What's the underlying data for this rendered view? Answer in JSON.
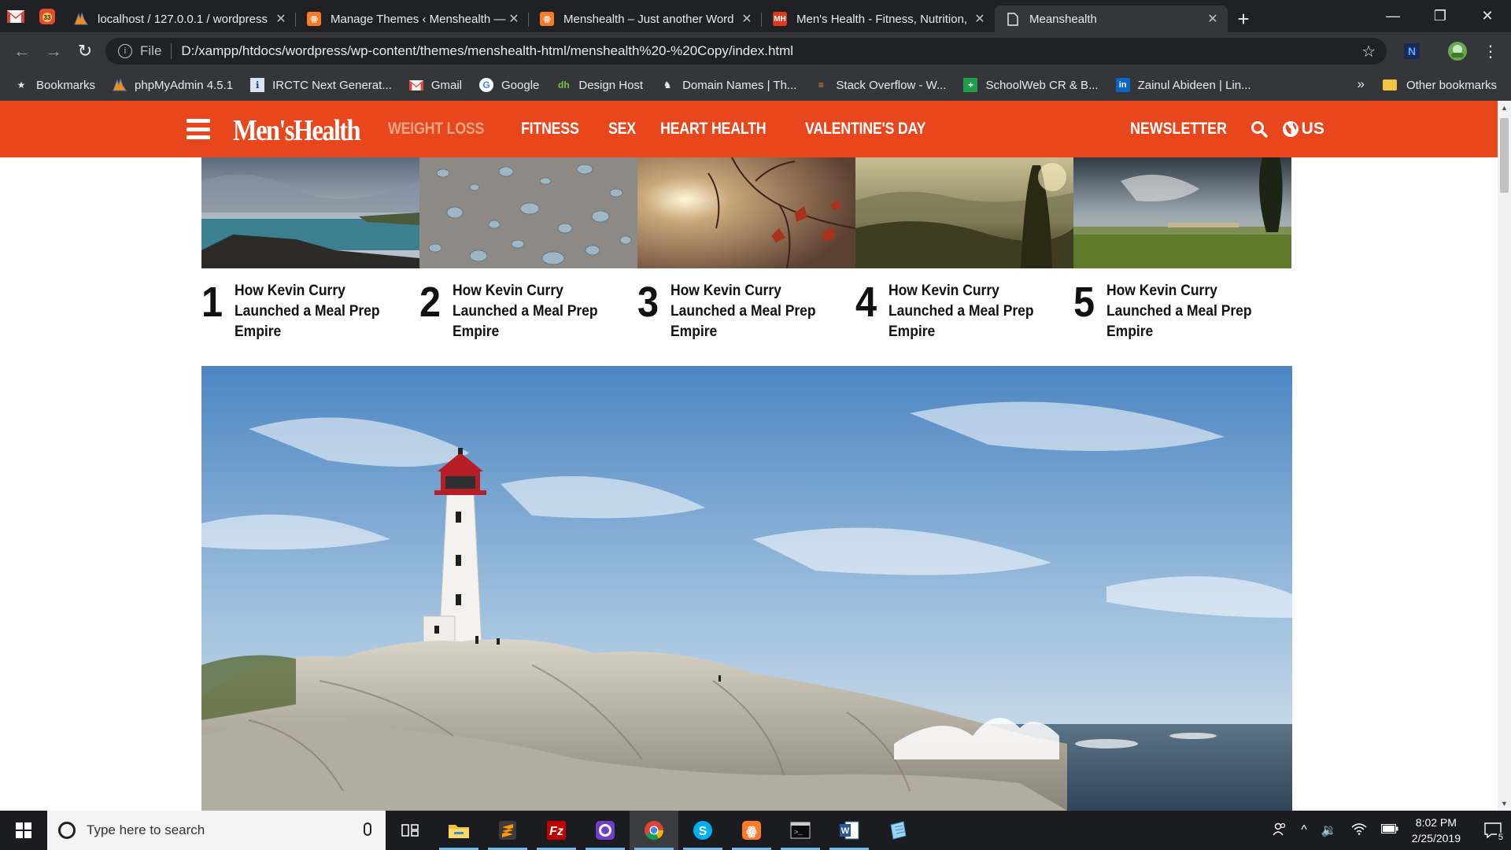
{
  "browser": {
    "tabs": [
      {
        "title": "localhost / 127.0.0.1 / wordpress",
        "icon": "phpmyadmin-icon"
      },
      {
        "title": "Manage Themes ‹ Menshealth —",
        "icon": "xampp-icon"
      },
      {
        "title": "Menshealth – Just another Word",
        "icon": "xampp-icon"
      },
      {
        "title": "Men's Health - Fitness, Nutrition,",
        "icon": "menshealth-icon"
      },
      {
        "title": "Meanshealth",
        "icon": "page-icon"
      }
    ],
    "gmail_badge": "33",
    "address_scheme": "File",
    "address_url": "D:/xampp/htdocs/wordpress/wp-content/themes/menshealth-html/menshealth%20-%20Copy/index.html",
    "bookmarks": [
      {
        "label": "Bookmarks",
        "icon": "star-icon"
      },
      {
        "label": "phpMyAdmin 4.5.1",
        "icon": "phpmyadmin-icon"
      },
      {
        "label": "IRCTC Next Generat...",
        "icon": "irctc-icon"
      },
      {
        "label": "Gmail",
        "icon": "gmail-icon"
      },
      {
        "label": "Google",
        "icon": "google-icon"
      },
      {
        "label": "Design Host",
        "icon": "designhost-icon"
      },
      {
        "label": "Domain Names | Th...",
        "icon": "domain-icon"
      },
      {
        "label": "Stack Overflow - W...",
        "icon": "stackoverflow-icon"
      },
      {
        "label": "SchoolWeb CR & B...",
        "icon": "schoolweb-icon"
      },
      {
        "label": "Zainul Abideen | Lin...",
        "icon": "linkedin-icon"
      }
    ],
    "bookmarks_overflow": "»",
    "other_bookmarks": "Other bookmarks"
  },
  "site": {
    "logo": "Men'sHealth",
    "nav": [
      "WEIGHT LOSS",
      "FITNESS",
      "SEX",
      "HEART HEALTH",
      "VALENTINE'S DAY"
    ],
    "newsletter": "NEWSLETTER",
    "region": "US",
    "brand_color": "#e8461c",
    "trending": [
      {
        "num": "1",
        "title": "How Kevin Curry Launched a Meal Prep Empire",
        "image": "coastal-cliff-sea"
      },
      {
        "num": "2",
        "title": "How Kevin Curry Launched a Meal Prep Empire",
        "image": "water-droplets"
      },
      {
        "num": "3",
        "title": "How Kevin Curry Launched a Meal Prep Empire",
        "image": "autumn-leaves-sun"
      },
      {
        "num": "4",
        "title": "How Kevin Curry Launched a Meal Prep Empire",
        "image": "misty-valley-sunset"
      },
      {
        "num": "5",
        "title": "How Kevin Curry Launched a Meal Prep Empire",
        "image": "stormy-golf-course"
      }
    ],
    "hero_image": "lighthouse-on-rocks"
  },
  "taskbar": {
    "search_placeholder": "Type here to search",
    "time": "8:02 PM",
    "date": "2/25/2019",
    "notifications": "5"
  }
}
